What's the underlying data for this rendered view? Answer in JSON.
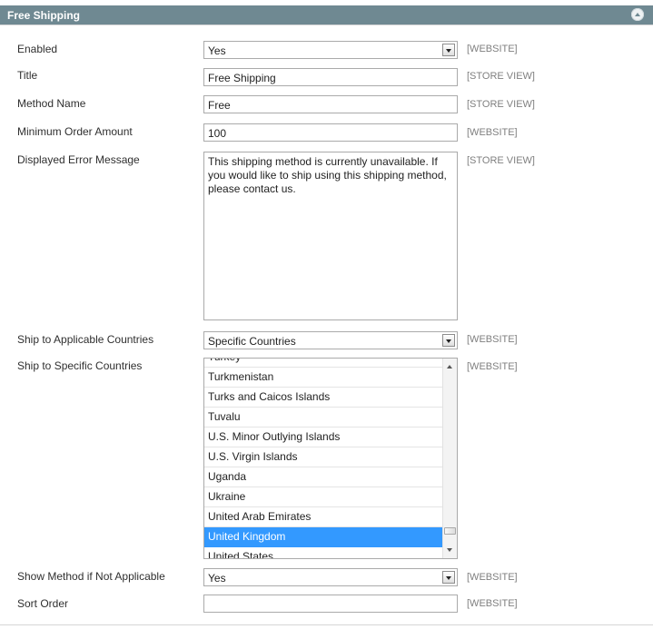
{
  "section": {
    "title": "Free Shipping",
    "collapse_icon": "chevron-up-circle-icon"
  },
  "fields": {
    "enabled": {
      "label": "Enabled",
      "value": "Yes",
      "scope": "[WEBSITE]"
    },
    "title": {
      "label": "Title",
      "value": "Free Shipping",
      "scope": "[STORE VIEW]"
    },
    "method_name": {
      "label": "Method Name",
      "value": "Free",
      "scope": "[STORE VIEW]"
    },
    "min_order": {
      "label": "Minimum Order Amount",
      "value": "100",
      "scope": "[WEBSITE]"
    },
    "error_message": {
      "label": "Displayed Error Message",
      "value": "This shipping method is currently unavailable. If you would like to ship using this shipping method, please contact us.",
      "scope": "[STORE VIEW]"
    },
    "applicable_countries": {
      "label": "Ship to Applicable Countries",
      "value": "Specific Countries",
      "scope": "[WEBSITE]"
    },
    "specific_countries": {
      "label": "Ship to Specific Countries",
      "scope": "[WEBSITE]",
      "options": [
        "Turkey",
        "Turkmenistan",
        "Turks and Caicos Islands",
        "Tuvalu",
        "U.S. Minor Outlying Islands",
        "U.S. Virgin Islands",
        "Uganda",
        "Ukraine",
        "United Arab Emirates",
        "United Kingdom",
        "United States"
      ],
      "selected": "United Kingdom"
    },
    "show_method": {
      "label": "Show Method if Not Applicable",
      "value": "Yes",
      "scope": "[WEBSITE]"
    },
    "sort_order": {
      "label": "Sort Order",
      "value": "",
      "scope": "[WEBSITE]"
    }
  },
  "colors": {
    "header_bg": "#6f8992",
    "selected_bg": "#3399ff",
    "scope_text": "#7f7f7f"
  }
}
